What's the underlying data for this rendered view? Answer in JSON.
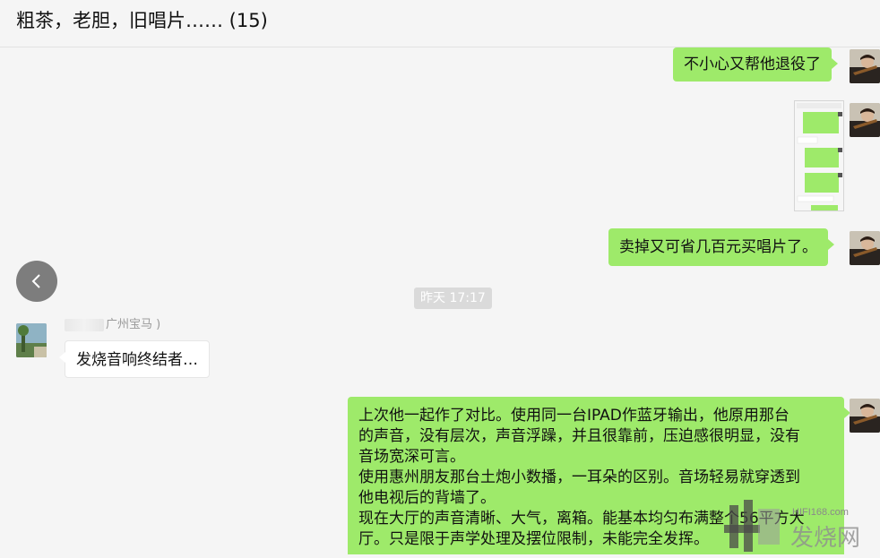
{
  "chat": {
    "title": "粗茶，老胆，旧唱片…… (15)"
  },
  "messages": {
    "m1": "不小心又帮他退役了",
    "m3": "卖掉又可省几百元买唱片了。",
    "timestamp": "昨天 17:17",
    "sender_suffix": "广州宝马 )",
    "incoming": "发烧音响终结者…",
    "long_lines": [
      "上次他一起作了对比。使用同一台IPAD作蓝牙输出，他原用那台",
      "的声音，没有层次，声音浮躁，并且很靠前，压迫感很明显，没有",
      "音场宽深可言。",
      "使用惠州朋友那台土炮小数播，一耳朵的区别。音场轻易就穿透到",
      "他电视后的背墙了。",
      "现在大厅的声音清晰、大气，离箱。能基本均匀布满整个56平方大",
      "厅。只是限于声学处理及摆位限制，未能完全发挥。"
    ]
  },
  "watermark": {
    "site": "HIFI168.com",
    "name": "发烧网"
  },
  "colors": {
    "bubble_green": "#9eea6a",
    "background": "#f5f5f5"
  },
  "icons": {
    "back": "chevron-left-icon"
  }
}
